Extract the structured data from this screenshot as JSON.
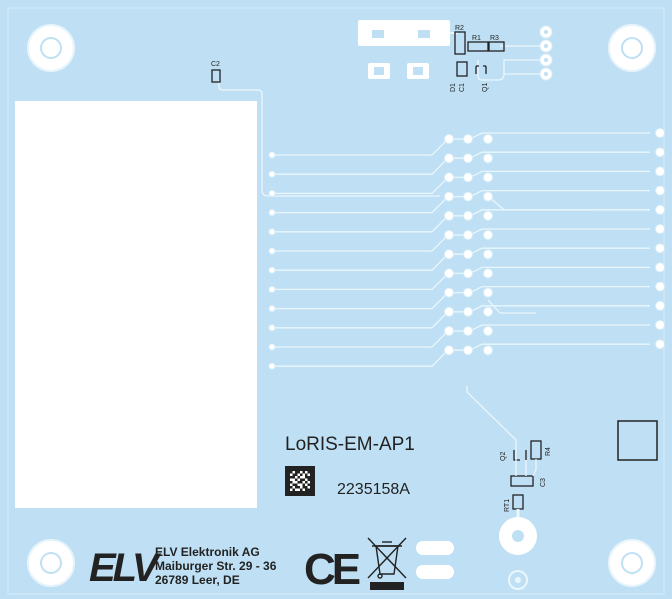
{
  "board": {
    "product_name": "LoRIS-EM-AP1",
    "serial_number": "2235158A",
    "manufacturer": {
      "logo": "ELV",
      "company": "ELV Elektronik AG",
      "street": "Maiburger Str. 29 - 36",
      "city": "26789 Leer, DE"
    },
    "ce_mark": "CE",
    "weee_icon": "crossed-out-wheelie-bin-icon",
    "datamatrix_icon": "datamatrix-code-icon"
  },
  "components": {
    "c1": "C1",
    "c2": "C2",
    "c3": "C3",
    "r1": "R1",
    "r2": "R2",
    "r3": "R3",
    "r4": "R4",
    "d1": "D1",
    "q1": "Q1",
    "q2": "Q2",
    "rt1": "RT1"
  },
  "colors": {
    "pcb": "#bfe0f4",
    "trace": "#eaf6fd",
    "pad": "#ffffff",
    "silkscreen": "#222222"
  }
}
